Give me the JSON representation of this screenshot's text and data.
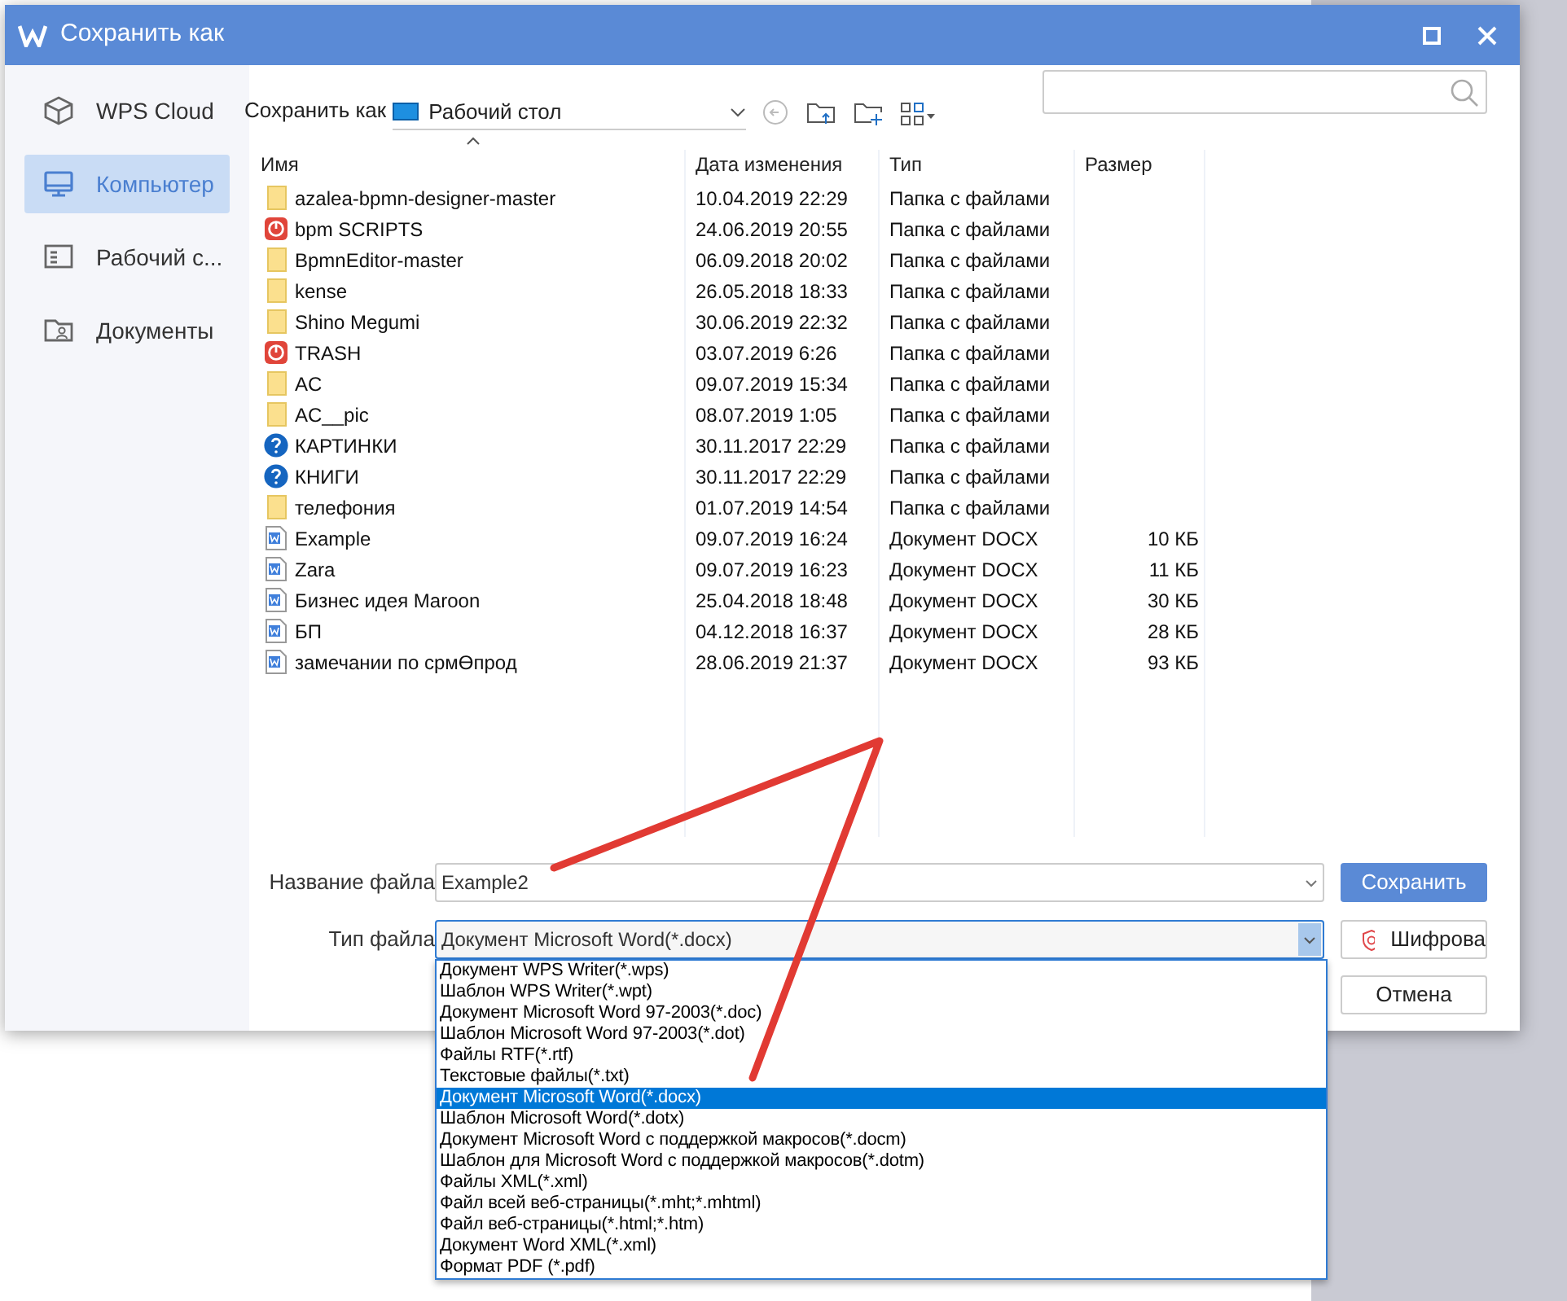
{
  "window": {
    "title": "Сохранить как"
  },
  "sidebar": {
    "items": [
      {
        "label": "WPS Cloud",
        "selected": false
      },
      {
        "label": "Компьютер",
        "selected": true
      },
      {
        "label": "Рабочий с...",
        "selected": false
      },
      {
        "label": "Документы",
        "selected": false
      }
    ]
  },
  "location": {
    "label": "Сохранить как",
    "value": "Рабочий стол"
  },
  "table": {
    "columns": [
      "Имя",
      "Дата изменения",
      "Тип",
      "Размер"
    ],
    "rows": [
      {
        "kind": "folder",
        "name": "azalea-bpmn-designer-master",
        "date": "10.04.2019 22:29",
        "type": "Папка с файлами"
      },
      {
        "kind": "restricted",
        "name": "bpm SCRIPTS",
        "date": "24.06.2019 20:55",
        "type": "Папка с файлами"
      },
      {
        "kind": "folder",
        "name": "BpmnEditor-master",
        "date": "06.09.2018 20:02",
        "type": "Папка с файлами"
      },
      {
        "kind": "folder",
        "name": "kense",
        "date": "26.05.2018 18:33",
        "type": "Папка с файлами"
      },
      {
        "kind": "folder",
        "name": "Shino Megumi",
        "date": "30.06.2019 22:32",
        "type": "Папка с файлами"
      },
      {
        "kind": "restricted",
        "name": "TRASH",
        "date": "03.07.2019 6:26",
        "type": "Папка с файлами"
      },
      {
        "kind": "folder",
        "name": "AC",
        "date": "09.07.2019 15:34",
        "type": "Папка с файлами"
      },
      {
        "kind": "folder",
        "name": "AC__pic",
        "date": "08.07.2019 1:05",
        "type": "Папка с файлами"
      },
      {
        "kind": "unknown",
        "name": "КАРТИНКИ",
        "date": "30.11.2017 22:29",
        "type": "Папка с файлами"
      },
      {
        "kind": "unknown",
        "name": "КНИГИ",
        "date": "30.11.2017 22:29",
        "type": "Папка с файлами"
      },
      {
        "kind": "folder",
        "name": "телефония",
        "date": "01.07.2019 14:54",
        "type": "Папка с файлами"
      },
      {
        "kind": "doc",
        "name": "Example",
        "date": "09.07.2019 16:24",
        "type": "Документ DOCX",
        "size": "10 КБ"
      },
      {
        "kind": "doc",
        "name": "Zara",
        "date": "09.07.2019 16:23",
        "type": "Документ DOCX",
        "size": "11 КБ"
      },
      {
        "kind": "doc",
        "name": "Бизнес идея Maroon",
        "date": "25.04.2018 18:48",
        "type": "Документ DOCX",
        "size": "30 КБ"
      },
      {
        "kind": "doc",
        "name": "БП",
        "date": "04.12.2018 16:37",
        "type": "Документ DOCX",
        "size": "28 КБ"
      },
      {
        "kind": "doc",
        "name": "замечании по срмӨпрод",
        "date": "28.06.2019 21:37",
        "type": "Документ DOCX",
        "size": "93 КБ"
      }
    ]
  },
  "filename": {
    "label": "Название файла",
    "value": "Example2"
  },
  "filetype": {
    "label": "Тип файла",
    "value": "Документ Microsoft Word(*.docx)",
    "options": [
      {
        "label": "Документ WPS Writer(*.wps)",
        "selected": false
      },
      {
        "label": "Шаблон WPS Writer(*.wpt)",
        "selected": false
      },
      {
        "label": "Документ Microsoft Word 97-2003(*.doc)",
        "selected": false
      },
      {
        "label": "Шаблон Microsoft Word 97-2003(*.dot)",
        "selected": false
      },
      {
        "label": "Файлы RTF(*.rtf)",
        "selected": false
      },
      {
        "label": "Текстовые файлы(*.txt)",
        "selected": false
      },
      {
        "label": "Документ Microsoft Word(*.docx)",
        "selected": true
      },
      {
        "label": "Шаблон Microsoft Word(*.dotx)",
        "selected": false
      },
      {
        "label": "Документ Microsoft Word с поддержкой макросов(*.docm)",
        "selected": false
      },
      {
        "label": "Шаблон для Microsoft Word с поддержкой макросов(*.dotm)",
        "selected": false
      },
      {
        "label": "Файлы XML(*.xml)",
        "selected": false
      },
      {
        "label": "Файл всей веб-страницы(*.mht;*.mhtml)",
        "selected": false
      },
      {
        "label": "Файл веб-страницы(*.html;*.htm)",
        "selected": false
      },
      {
        "label": "Документ Word XML(*.xml)",
        "selected": false
      },
      {
        "label": "Формат PDF (*.pdf)",
        "selected": false
      }
    ]
  },
  "buttons": [
    "Сохранить",
    "Шифрова",
    "Отмена"
  ]
}
